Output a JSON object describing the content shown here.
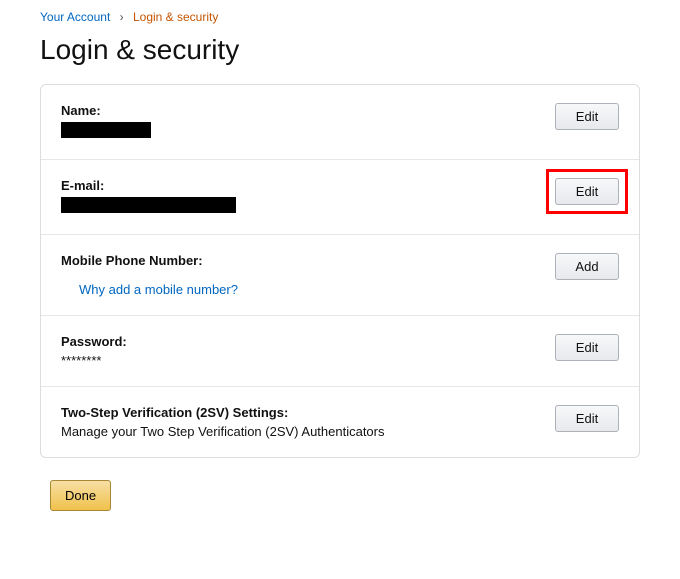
{
  "breadcrumb": {
    "root": "Your Account",
    "separator": "›",
    "current": "Login & security"
  },
  "page_title": "Login & security",
  "rows": {
    "name": {
      "label": "Name:",
      "button": "Edit"
    },
    "email": {
      "label": "E-mail:",
      "button": "Edit"
    },
    "phone": {
      "label": "Mobile Phone Number:",
      "link": "Why add a mobile number?",
      "button": "Add"
    },
    "password": {
      "label": "Password:",
      "value": "********",
      "button": "Edit"
    },
    "twostep": {
      "label": "Two-Step Verification (2SV) Settings:",
      "sub": "Manage your Two Step Verification (2SV) Authenticators",
      "button": "Edit"
    }
  },
  "done_label": "Done"
}
